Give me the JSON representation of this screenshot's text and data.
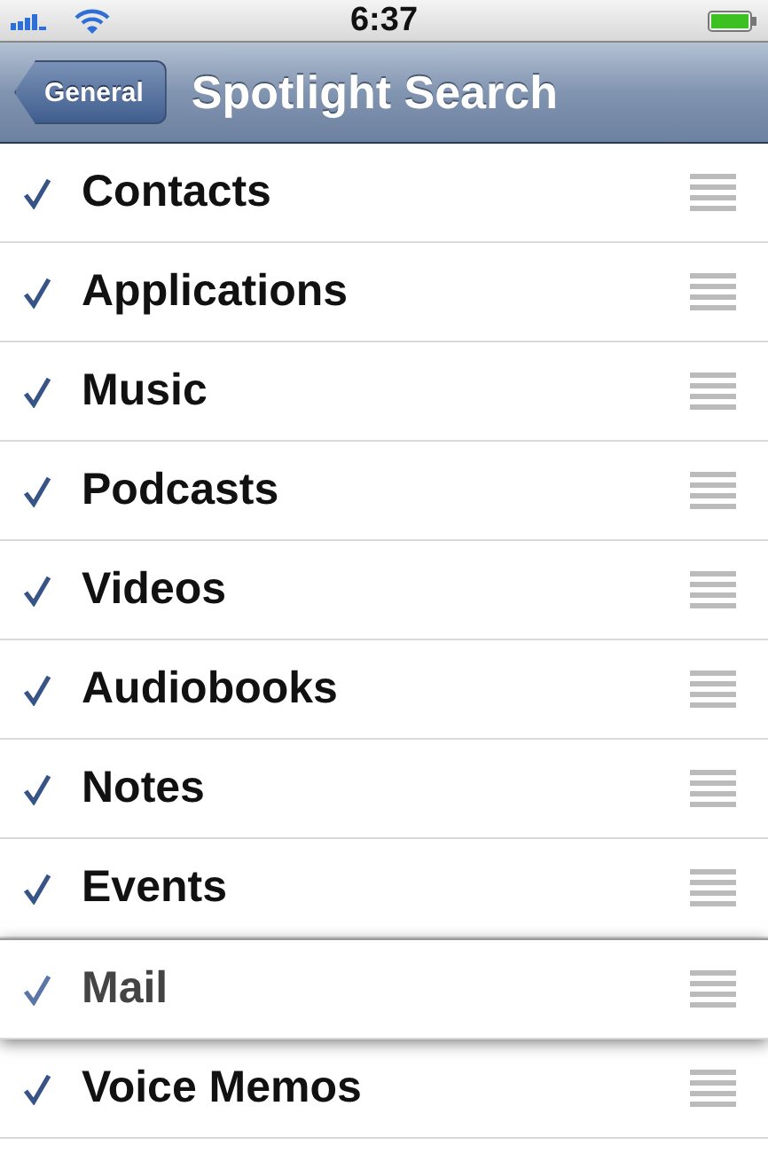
{
  "status_bar": {
    "time": "6:37"
  },
  "nav_bar": {
    "back_button": "General",
    "title": "Spotlight Search"
  },
  "items": [
    {
      "label": "Contacts",
      "checked": true,
      "dragging": false
    },
    {
      "label": "Applications",
      "checked": true,
      "dragging": false
    },
    {
      "label": "Music",
      "checked": true,
      "dragging": false
    },
    {
      "label": "Podcasts",
      "checked": true,
      "dragging": false
    },
    {
      "label": "Videos",
      "checked": true,
      "dragging": false
    },
    {
      "label": "Audiobooks",
      "checked": true,
      "dragging": false
    },
    {
      "label": "Notes",
      "checked": true,
      "dragging": false
    },
    {
      "label": "Events",
      "checked": true,
      "dragging": false
    },
    {
      "label": "Mail",
      "checked": true,
      "dragging": true
    },
    {
      "label": "Voice Memos",
      "checked": true,
      "dragging": false
    }
  ]
}
